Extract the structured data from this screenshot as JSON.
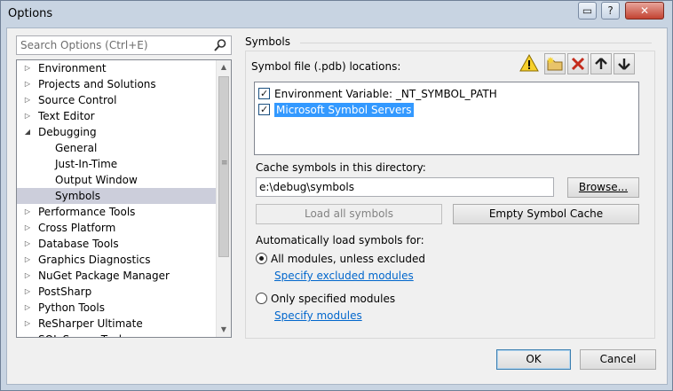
{
  "window": {
    "title": "Options",
    "help_label": "?",
    "close_label": "✕",
    "restore_label": "▭"
  },
  "search": {
    "placeholder": "Search Options (Ctrl+E)"
  },
  "tree": {
    "items": [
      {
        "label": "Environment",
        "expander": "▷"
      },
      {
        "label": "Projects and Solutions",
        "expander": "▷"
      },
      {
        "label": "Source Control",
        "expander": "▷"
      },
      {
        "label": "Text Editor",
        "expander": "▷"
      },
      {
        "label": "Debugging",
        "expander": "◢"
      },
      {
        "label": "General"
      },
      {
        "label": "Just-In-Time"
      },
      {
        "label": "Output Window"
      },
      {
        "label": "Symbols",
        "selected": true
      },
      {
        "label": "Performance Tools",
        "expander": "▷"
      },
      {
        "label": "Cross Platform",
        "expander": "▷"
      },
      {
        "label": "Database Tools",
        "expander": "▷"
      },
      {
        "label": "Graphics Diagnostics",
        "expander": "▷"
      },
      {
        "label": "NuGet Package Manager",
        "expander": "▷"
      },
      {
        "label": "PostSharp",
        "expander": "▷"
      },
      {
        "label": "Python Tools",
        "expander": "▷"
      },
      {
        "label": "ReSharper Ultimate",
        "expander": "▷"
      },
      {
        "label": "SQL Server Tools",
        "expander": "▷"
      }
    ]
  },
  "symbols": {
    "section_title": "Symbols",
    "locations_label": "Symbol file (.pdb) locations:",
    "locations": [
      {
        "label": "Environment Variable: _NT_SYMBOL_PATH",
        "checked": true
      },
      {
        "label": "Microsoft Symbol Servers",
        "checked": true,
        "selected": true
      }
    ],
    "toolbar": [
      "warning-icon",
      "new-folder-icon",
      "delete-icon",
      "move-up-icon",
      "move-down-icon"
    ],
    "cache_label": "Cache symbols in this directory:",
    "cache_path": "e:\\debug\\symbols",
    "browse_label": "Browse...",
    "load_all_label": "Load all symbols",
    "empty_cache_label": "Empty Symbol Cache",
    "auto_load_label": "Automatically load symbols for:",
    "option_all": "All modules, unless excluded",
    "link_excluded": "Specify excluded modules",
    "option_only": "Only specified modules",
    "link_modules": "Specify modules",
    "selected_option": "all"
  },
  "footer": {
    "ok_label": "OK",
    "cancel_label": "Cancel"
  }
}
